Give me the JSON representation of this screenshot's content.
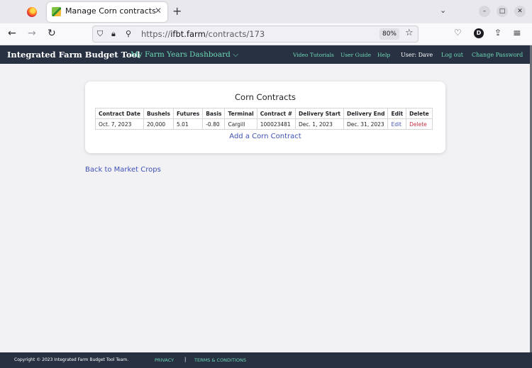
{
  "browser": {
    "tab_title": "Manage Corn contracts",
    "url_prefix": "https://",
    "url_host": "ifbt.farm",
    "url_path": "/contracts/173",
    "zoom": "80%",
    "profile_initial": "D"
  },
  "app_nav": {
    "brand": "Integrated Farm Budget Tool",
    "my_farm_years": "My Farm Years",
    "dashboard": "Dashboard",
    "video_tutorials": "Video Tutorials",
    "user_guide": "User Guide",
    "help": "Help",
    "user": "User: Dave",
    "log_out": "Log out",
    "change_password": "Change Password"
  },
  "card": {
    "title": "Corn Contracts",
    "columns": [
      "Contract Date",
      "Bushels",
      "Futures",
      "Basis",
      "Terminal",
      "Contract #",
      "Delivery Start",
      "Delivery End",
      "Edit",
      "Delete"
    ],
    "rows": [
      {
        "contract_date": "Oct. 7, 2023",
        "bushels": "20,000",
        "futures": "5.01",
        "basis": "-0.80",
        "terminal": "Cargill",
        "contract_no": "100023481",
        "delivery_start": "Dec. 1, 2023",
        "delivery_end": "Dec. 31, 2023",
        "edit": "Edit",
        "delete": "Delete"
      }
    ],
    "add_link": "Add a Corn Contract"
  },
  "back_link": "Back to Market Crops",
  "footer": {
    "copyright": "Copyright © 2023 Integrated Farm Budget Tool Team.",
    "privacy": "PRIVACY",
    "separator": "|",
    "terms": "TERMS & CONDITIONS"
  },
  "colors": {
    "navbar_bg": "#273142",
    "link_teal": "#6ed7b5",
    "link_blue": "#3f51b5",
    "delete_red": "#c03040"
  }
}
